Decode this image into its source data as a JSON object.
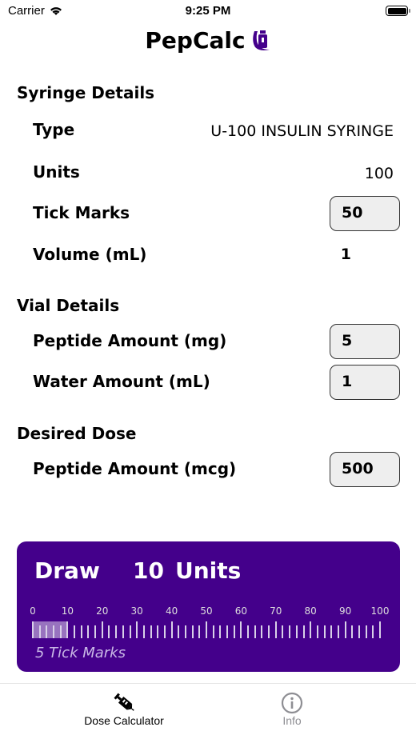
{
  "status_bar": {
    "carrier": "Carrier",
    "time": "9:25 PM"
  },
  "app": {
    "title": "PepCalc",
    "brand_color": "#44008b"
  },
  "syringe": {
    "heading": "Syringe Details",
    "type_label": "Type",
    "type_value": "U-100 INSULIN SYRINGE",
    "units_label": "Units",
    "units_value": "100",
    "tick_label": "Tick Marks",
    "tick_value": "50",
    "volume_label": "Volume (mL)",
    "volume_value": "1"
  },
  "vial": {
    "heading": "Vial Details",
    "peptide_label": "Peptide Amount (mg)",
    "peptide_value": "5",
    "water_label": "Water Amount (mL)",
    "water_value": "1"
  },
  "dose": {
    "heading": "Desired Dose",
    "peptide_label": "Peptide Amount (mcg)",
    "peptide_value": "500"
  },
  "result": {
    "draw_label": "Draw",
    "draw_value": "10",
    "draw_unit": "Units",
    "tick_marks_text": "5 Tick Marks",
    "scale_labels": [
      "0",
      "10",
      "20",
      "30",
      "40",
      "50",
      "60",
      "70",
      "80",
      "90",
      "100"
    ],
    "scale_max": 100,
    "tick_step": 2,
    "filled_units": 10
  },
  "tabs": [
    {
      "label": "Dose Calculator",
      "active": true
    },
    {
      "label": "Info",
      "active": false
    }
  ]
}
